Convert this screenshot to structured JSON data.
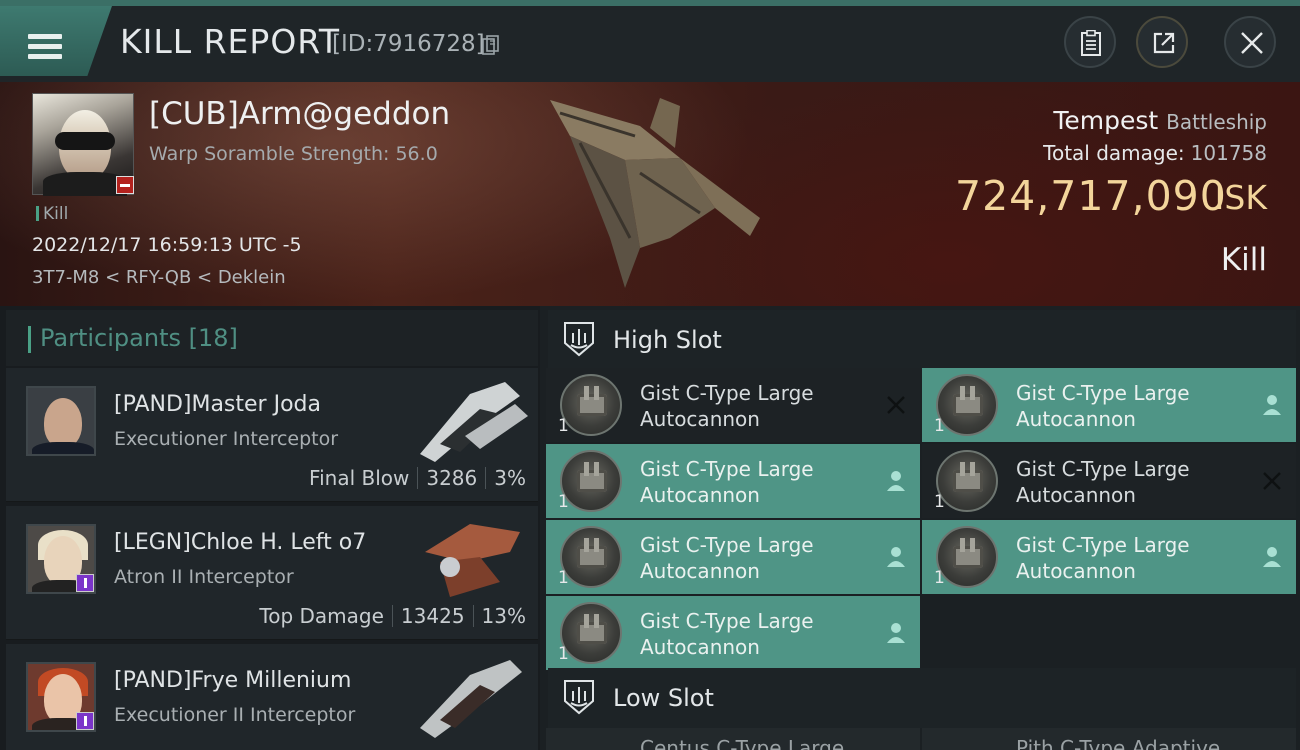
{
  "header": {
    "title": "KILL REPORT",
    "report_id": "[ID:7916728]"
  },
  "victim": {
    "name": "[CUB]Arm@geddon",
    "scramble": "Warp Soramble Strength: 56.0",
    "kill_tag": "Kill",
    "datetime": "2022/12/17 16:59:13 UTC -5",
    "location": "3T7-M8 < RFY-QB < Deklein",
    "ship_name": "Tempest",
    "ship_class": "Battleship",
    "total_damage_label": "Total damage:",
    "total_damage": "101758",
    "isk_value": "724,717,090",
    "isk_unit": "ISK",
    "result": "Kill"
  },
  "participants": {
    "title": "Participants [18]",
    "rows": [
      {
        "name": "[PAND]Master Joda",
        "ship": "Executioner Interceptor",
        "label": "Final Blow",
        "damage": "3286",
        "percent": "3%"
      },
      {
        "name": "[LEGN]Chloe H. Left o7",
        "ship": "Atron II Interceptor",
        "label": "Top Damage",
        "damage": "13425",
        "percent": "13%"
      },
      {
        "name": "[PAND]Frye Millenium",
        "ship": "Executioner II Interceptor",
        "label": "",
        "damage": "",
        "percent": ""
      }
    ]
  },
  "slots": {
    "high_title": "High Slot",
    "low_title": "Low Slot",
    "modules": [
      {
        "line1": "Gist C-Type Large",
        "line2": "Autocannon",
        "count": "1",
        "state": "destroyed"
      },
      {
        "line1": "Gist C-Type Large",
        "line2": "Autocannon",
        "count": "1",
        "state": "dropped"
      },
      {
        "line1": "Gist C-Type Large",
        "line2": "Autocannon",
        "count": "1",
        "state": "dropped"
      },
      {
        "line1": "Gist C-Type Large",
        "line2": "Autocannon",
        "count": "1",
        "state": "destroyed"
      },
      {
        "line1": "Gist C-Type Large",
        "line2": "Autocannon",
        "count": "1",
        "state": "dropped"
      },
      {
        "line1": "Gist C-Type Large",
        "line2": "Autocannon",
        "count": "1",
        "state": "dropped"
      },
      {
        "line1": "Gist C-Type Large",
        "line2": "Autocannon",
        "count": "1",
        "state": "dropped"
      }
    ],
    "low_peek": [
      "Centus C-Type Large...",
      "Pith C-Type Adaptive..."
    ]
  },
  "colors": {
    "accent": "#4f9586",
    "isk": "#f3d59b",
    "badge_red": "#b3221e",
    "badge_purple": "#7b35c9"
  },
  "icons": [
    "menu-icon",
    "copy-icon",
    "clipboard-icon",
    "share-icon",
    "close-icon",
    "high-slot-icon",
    "low-slot-icon",
    "pilot-icon",
    "x-icon"
  ]
}
